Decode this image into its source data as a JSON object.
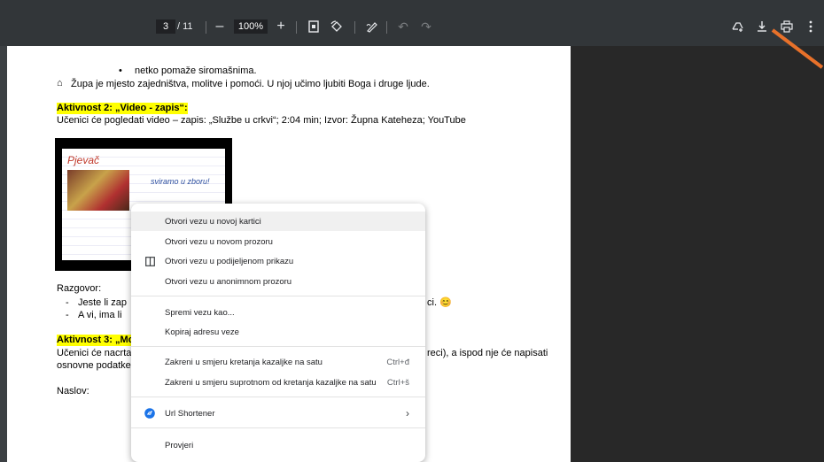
{
  "toolbar": {
    "page_current": "3",
    "page_total": "/ 11",
    "zoom": "100%",
    "zoom_out": "–",
    "zoom_in": "+"
  },
  "document": {
    "bullet_text": "netko pomaže siromašnima.",
    "house_text": "Župa je mjesto zajedništva, molitve i pomoći. U njoj učimo ljubiti Boga i druge ljude.",
    "activity2_title": "Aktivnost 2: „Video - zapis“:",
    "activity2_desc": "Učenici će pogledati video – zapis: „Službe u crkvi“; 2:04 min; Izvor: Župna Kateheza; YouTube",
    "video_title": "Pjevač",
    "video_sub": "sviramo u zboru!",
    "razgovor": "Razgovor:",
    "q1_start": "Jeste li zap",
    "q1_end": "ci. 😊",
    "q2_start": "A vi, ima li",
    "activity3_title": "Aktivnost 3: „Moj",
    "activity3_line1_start": "Učenici će nacrtati",
    "activity3_line1_end": "reci), a ispod nje će napisati",
    "activity3_line2": "osnovne podatke",
    "naslov": "Naslov:"
  },
  "context_menu": {
    "items": [
      {
        "label": "Otvori vezu u novoj kartici",
        "shortcut": ""
      },
      {
        "label": "Otvori vezu u novom prozoru",
        "shortcut": ""
      },
      {
        "label": "Otvori vezu u podijeljenom prikazu",
        "shortcut": ""
      },
      {
        "label": "Otvori vezu u anonimnom prozoru",
        "shortcut": ""
      },
      {
        "label": "Spremi vezu kao...",
        "shortcut": ""
      },
      {
        "label": "Kopiraj adresu veze",
        "shortcut": ""
      },
      {
        "label": "Zakreni u smjeru kretanja kazaljke na satu",
        "shortcut": "Ctrl+đ"
      },
      {
        "label": "Zakreni u smjeru suprotnom od kretanja kazaljke na satu",
        "shortcut": "Ctrl+š"
      },
      {
        "label": "Url Shortener",
        "shortcut": "›"
      },
      {
        "label": "Provjeri",
        "shortcut": ""
      }
    ]
  },
  "colors": {
    "toolbar_bg": "#323639",
    "highlight": "#ffff00",
    "annotation_arrow": "#e8712a"
  }
}
